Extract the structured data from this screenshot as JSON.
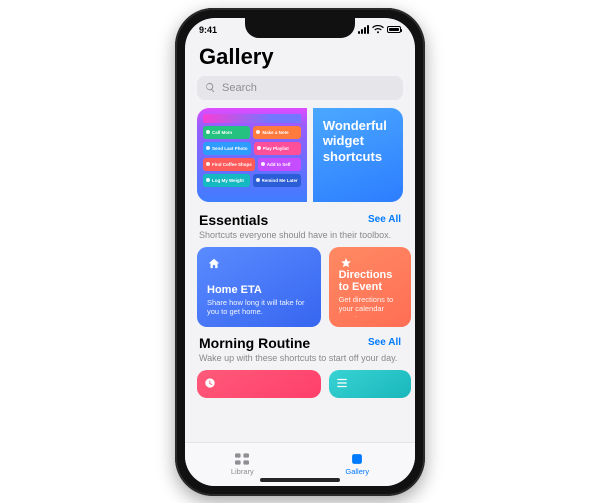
{
  "status": {
    "time": "9:41"
  },
  "page": {
    "title": "Gallery"
  },
  "search": {
    "placeholder": "Search"
  },
  "hero": {
    "title": "Wonderful widget shortcuts",
    "pills": [
      "Call Mom",
      "Make a Note",
      "Send Last Photo",
      "Play Playlist",
      "Find Coffee Shops",
      "Add to Self",
      "Log My Weight",
      "Remind Me Later"
    ]
  },
  "sections": [
    {
      "title": "Essentials",
      "subtitle": "Shortcuts everyone should have in their toolbox.",
      "see_all": "See All",
      "cards": [
        {
          "title": "Home ETA",
          "desc": "Share how long it will take for you to get home."
        },
        {
          "title": "Directions to Event",
          "desc": "Get directions to your calendar event."
        }
      ]
    },
    {
      "title": "Morning Routine",
      "subtitle": "Wake up with these shortcuts to start off your day.",
      "see_all": "See All"
    }
  ],
  "tabs": {
    "library": "Library",
    "gallery": "Gallery"
  }
}
